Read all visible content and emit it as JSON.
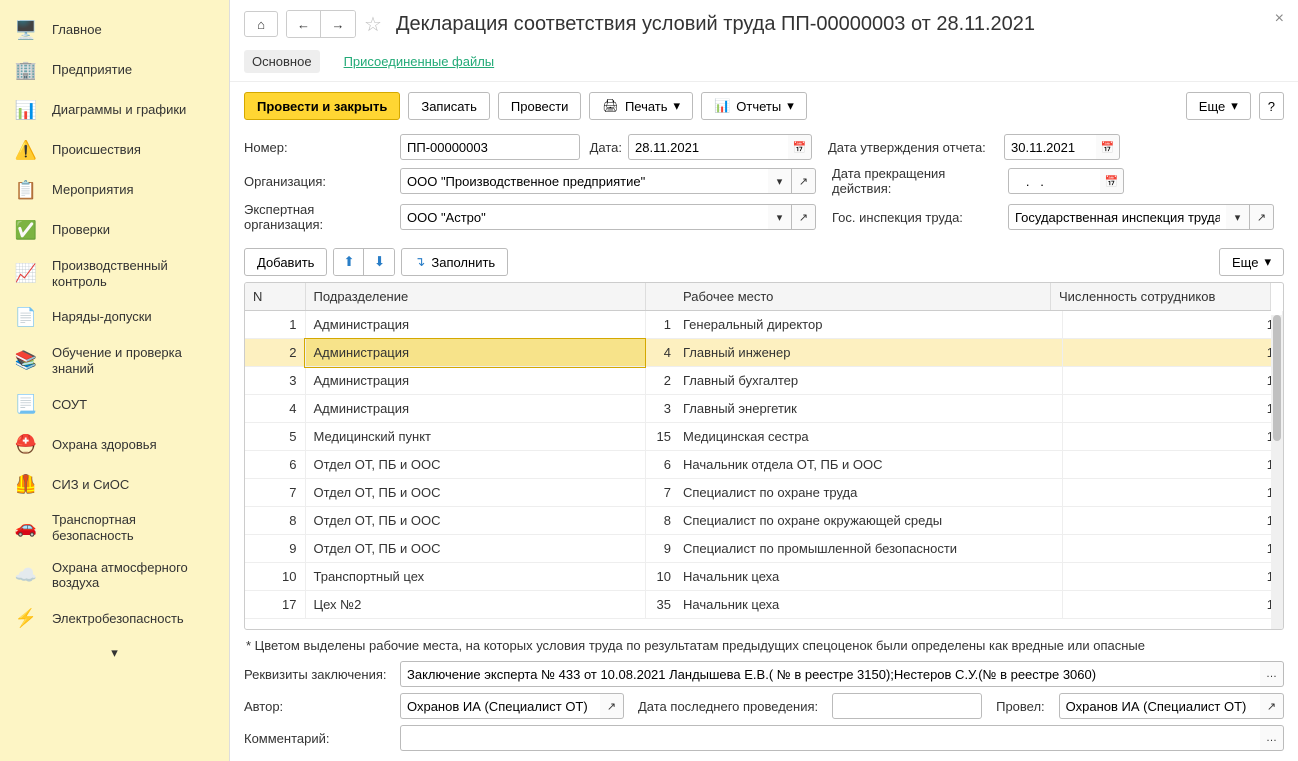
{
  "sidebar": {
    "items": [
      {
        "label": "Главное"
      },
      {
        "label": "Предприятие"
      },
      {
        "label": "Диаграммы и графики"
      },
      {
        "label": "Происшествия"
      },
      {
        "label": "Мероприятия"
      },
      {
        "label": "Проверки"
      },
      {
        "label": "Производственный контроль"
      },
      {
        "label": "Наряды-допуски"
      },
      {
        "label": "Обучение и проверка знаний"
      },
      {
        "label": "СОУТ"
      },
      {
        "label": "Охрана здоровья"
      },
      {
        "label": "СИЗ и СиОС"
      },
      {
        "label": "Транспортная безопасность"
      },
      {
        "label": "Охрана атмосферного воздуха"
      },
      {
        "label": "Электробезопасность"
      }
    ]
  },
  "header": {
    "title": "Декларация соответствия условий труда ПП-00000003 от 28.11.2021"
  },
  "tabs": {
    "main": "Основное",
    "files": "Присоединенные файлы"
  },
  "toolbar": {
    "post_close": "Провести и закрыть",
    "save": "Записать",
    "post": "Провести",
    "print": "Печать",
    "reports": "Отчеты",
    "more": "Еще"
  },
  "fields": {
    "number_label": "Номер:",
    "number_value": "ПП-00000003",
    "date_label": "Дата:",
    "date_value": "28.11.2021",
    "approval_date_label": "Дата утверждения отчета:",
    "approval_date_value": "30.11.2021",
    "org_label": "Организация:",
    "org_value": "ООО \"Производственное предприятие\"",
    "termination_label": "Дата прекращения действия:",
    "termination_value": "   .   .",
    "expert_org_label": "Экспертная организация:",
    "expert_org_value": "ООО \"Астро\"",
    "inspection_label": "Гос. инспекция труда:",
    "inspection_value": "Государственная инспекция труда в"
  },
  "table_toolbar": {
    "add": "Добавить",
    "fill": "Заполнить",
    "more": "Еще"
  },
  "table": {
    "headers": {
      "n": "N",
      "dept": "Подразделение",
      "workplace": "Рабочее место",
      "count": "Численность сотрудников"
    },
    "rows": [
      {
        "n": "1",
        "dept": "Администрация",
        "wpn": "1",
        "wp": "Генеральный директор",
        "count": "1"
      },
      {
        "n": "2",
        "dept": "Администрация",
        "wpn": "4",
        "wp": "Главный инженер",
        "count": "1",
        "selected": true
      },
      {
        "n": "3",
        "dept": "Администрация",
        "wpn": "2",
        "wp": "Главный бухгалтер",
        "count": "1"
      },
      {
        "n": "4",
        "dept": "Администрация",
        "wpn": "3",
        "wp": "Главный энергетик",
        "count": "1"
      },
      {
        "n": "5",
        "dept": "Медицинский пункт",
        "wpn": "15",
        "wp": "Медицинская сестра",
        "count": "1"
      },
      {
        "n": "6",
        "dept": "Отдел ОТ, ПБ и ООС",
        "wpn": "6",
        "wp": "Начальник отдела ОТ, ПБ и ООС",
        "count": "1"
      },
      {
        "n": "7",
        "dept": "Отдел ОТ, ПБ и ООС",
        "wpn": "7",
        "wp": "Специалист по охране труда",
        "count": "1"
      },
      {
        "n": "8",
        "dept": "Отдел ОТ, ПБ и ООС",
        "wpn": "8",
        "wp": "Специалист по охране окружающей среды",
        "count": "1"
      },
      {
        "n": "9",
        "dept": "Отдел ОТ, ПБ и ООС",
        "wpn": "9",
        "wp": "Специалист по промышленной безопасности",
        "count": "1"
      },
      {
        "n": "10",
        "dept": "Транспортный цех",
        "wpn": "10",
        "wp": "Начальник цеха",
        "count": "1"
      },
      {
        "n": "17",
        "dept": "Цех №2",
        "wpn": "35",
        "wp": "Начальник цеха",
        "count": "1"
      }
    ]
  },
  "note": "* Цветом выделены рабочие места, на которых условия труда по результатам предыдущих спецоценок были определены как вредные или опасные",
  "bottom": {
    "details_label": "Реквизиты заключения:",
    "details_value": "Заключение эксперта № 433 от 10.08.2021 Ландышева Е.В.( № в реестре 3150);Нестеров С.У.(№ в реестре 3060)",
    "author_label": "Автор:",
    "author_value": "Охранов ИА (Специалист ОТ)",
    "last_date_label": "Дата последнего проведения:",
    "last_date_value": "",
    "conducted_label": "Провел:",
    "conducted_value": "Охранов ИА (Специалист ОТ)",
    "comment_label": "Комментарий:",
    "comment_value": ""
  }
}
